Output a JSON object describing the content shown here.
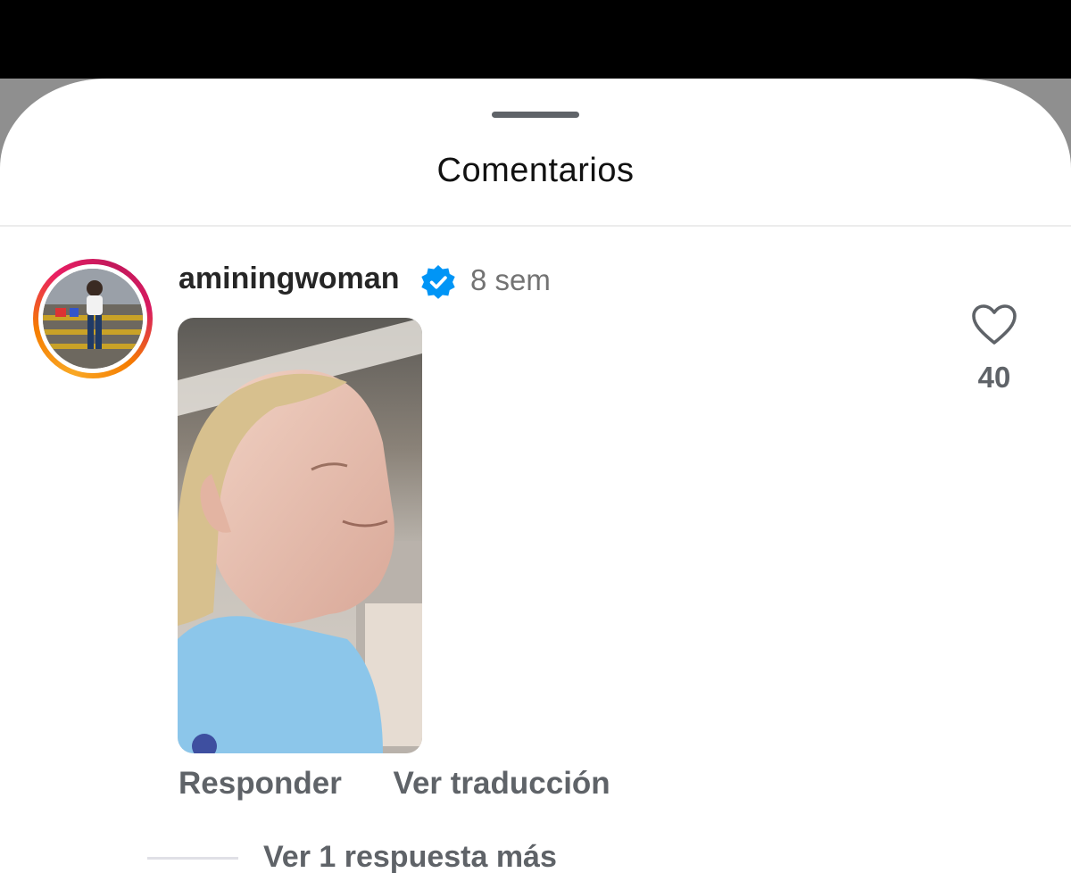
{
  "sheet": {
    "title": "Comentarios"
  },
  "comment": {
    "username": "aminingwoman",
    "verified": true,
    "time_ago": "8 sem",
    "like_count": "40",
    "reply_label": "Responder",
    "translate_label": "Ver traducción",
    "view_replies_label": "Ver 1 respuesta más"
  },
  "icons": {
    "verified": "verified-badge-icon",
    "like": "heart-outline-icon"
  },
  "colors": {
    "verified_blue": "#0095f6",
    "secondary_text": "#737373",
    "action_text": "#5f6368"
  }
}
